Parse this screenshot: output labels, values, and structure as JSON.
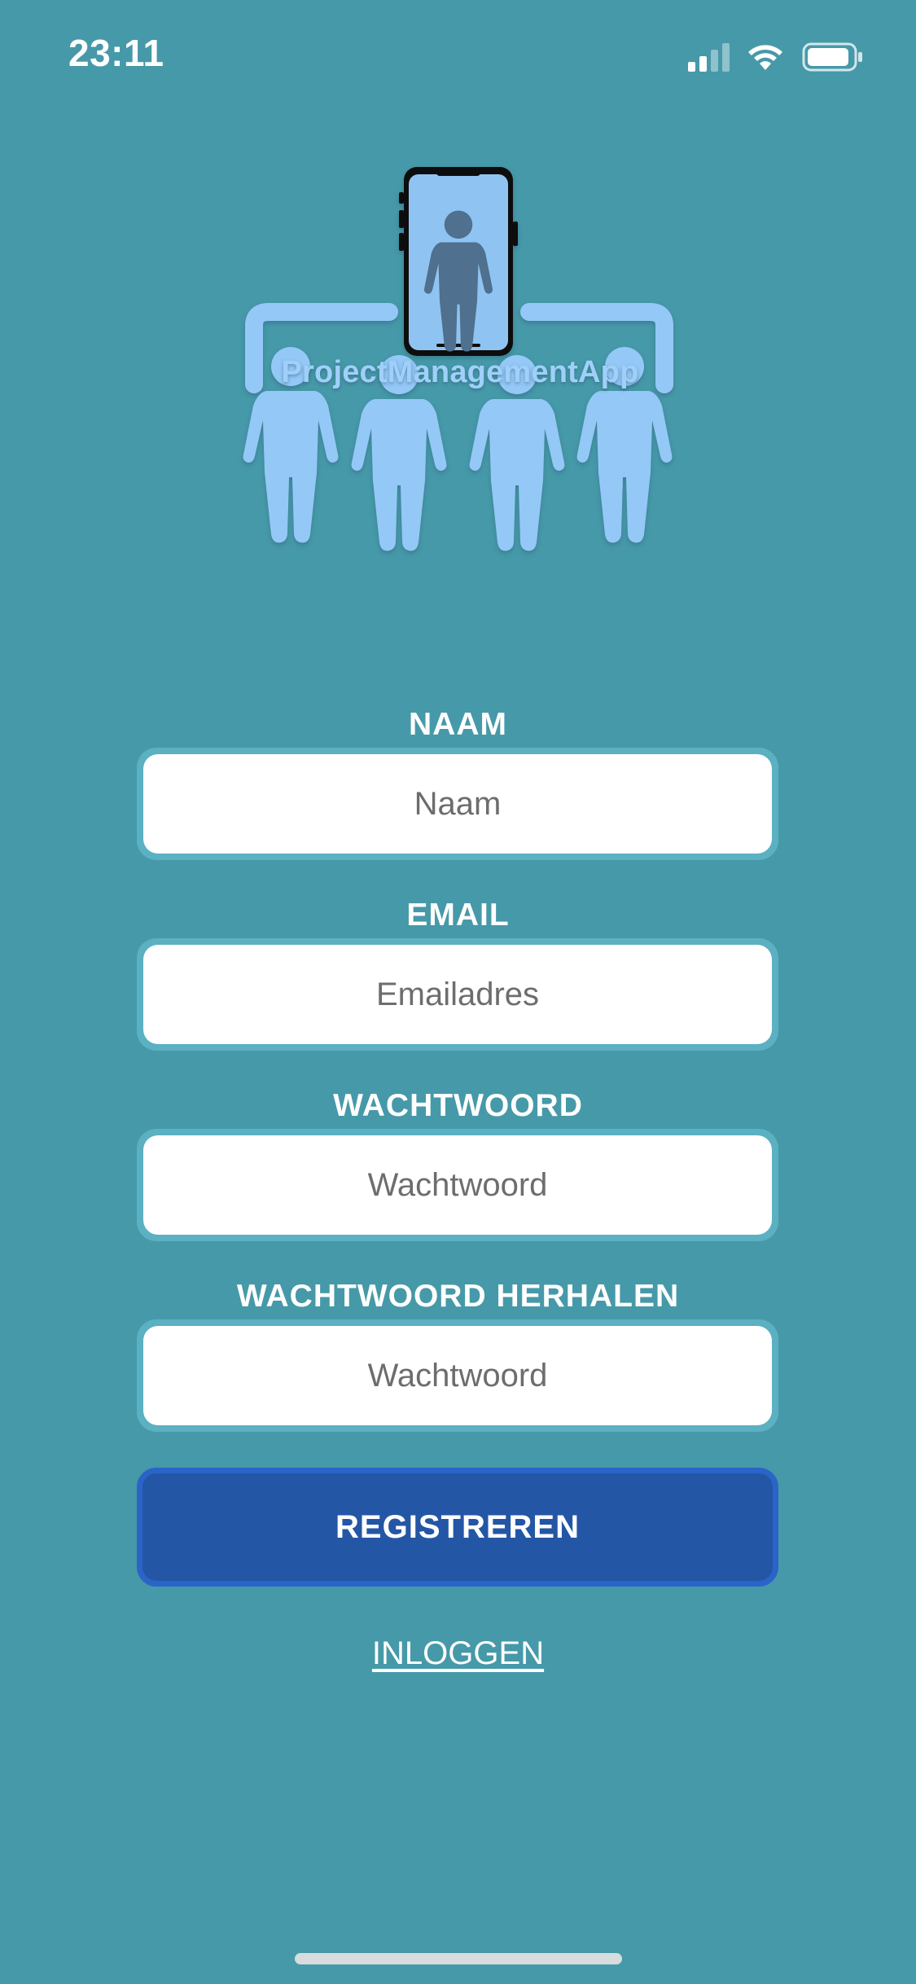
{
  "status_bar": {
    "time": "23:11"
  },
  "logo": {
    "text": "ProjectManagementApp",
    "colors": {
      "figure": "#94c8f7",
      "phone_screen": "#8fc4f2",
      "phone_person": "#4f6f8e"
    }
  },
  "form": {
    "name": {
      "label": "NAAM",
      "placeholder": "Naam",
      "value": ""
    },
    "email": {
      "label": "EMAIL",
      "placeholder": "Emailadres",
      "value": ""
    },
    "password": {
      "label": "WACHTWOORD",
      "placeholder": "Wachtwoord",
      "value": ""
    },
    "password_repeat": {
      "label": "WACHTWOORD HERHALEN",
      "placeholder": "Wachtwoord",
      "value": ""
    },
    "register_label": "REGISTREREN",
    "login_label": "INLOGGEN"
  },
  "colors": {
    "background": "#4699a8",
    "button": "#2456a6",
    "button_border": "#2b64c8",
    "field_border": "#5bb0c2"
  }
}
